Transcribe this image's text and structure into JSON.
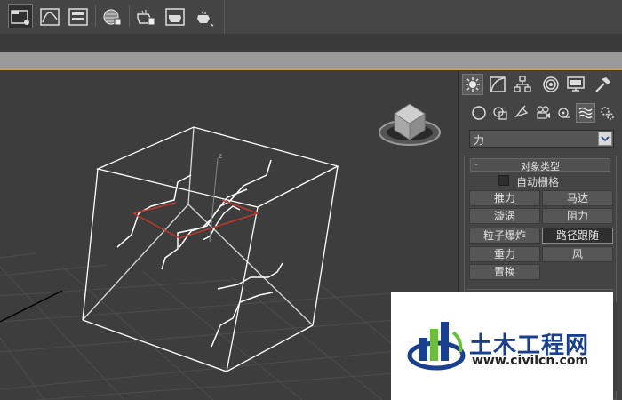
{
  "toolbar": {
    "buttons": [
      "layer-manager",
      "curve-editor",
      "schematic-view",
      "material-editor",
      "render-setup",
      "rendered-frame-window",
      "render-production"
    ]
  },
  "command_panel": {
    "tabs": [
      "create",
      "modify",
      "hierarchy",
      "motion",
      "display",
      "utilities"
    ],
    "subtabs": [
      "geometry",
      "shapes",
      "lights",
      "cameras",
      "helpers",
      "space-warps",
      "systems"
    ],
    "category_dropdown": "力",
    "rollout": {
      "collapse_symbol": "-",
      "title": "对象类型",
      "auto_grid_label": "自动栅格",
      "buttons": [
        "推力",
        "马达",
        "漩涡",
        "阻力",
        "粒子爆炸",
        "路径跟随",
        "重力",
        "风",
        "置换"
      ],
      "selected": "路径跟随"
    }
  },
  "viewport": {
    "gizmo_axis_label": "z"
  },
  "watermark": {
    "name": "土木工程网",
    "url": "www.civilcn.com",
    "colors": {
      "blue": "#1b3f8f",
      "green": "#6cbf3c"
    }
  },
  "colors": {
    "ui_background": "#444444",
    "viewport": "#3d3d3d",
    "accent_border": "#c9a451",
    "wireframe": "#ffffff",
    "selection_red": "#c0392b"
  }
}
